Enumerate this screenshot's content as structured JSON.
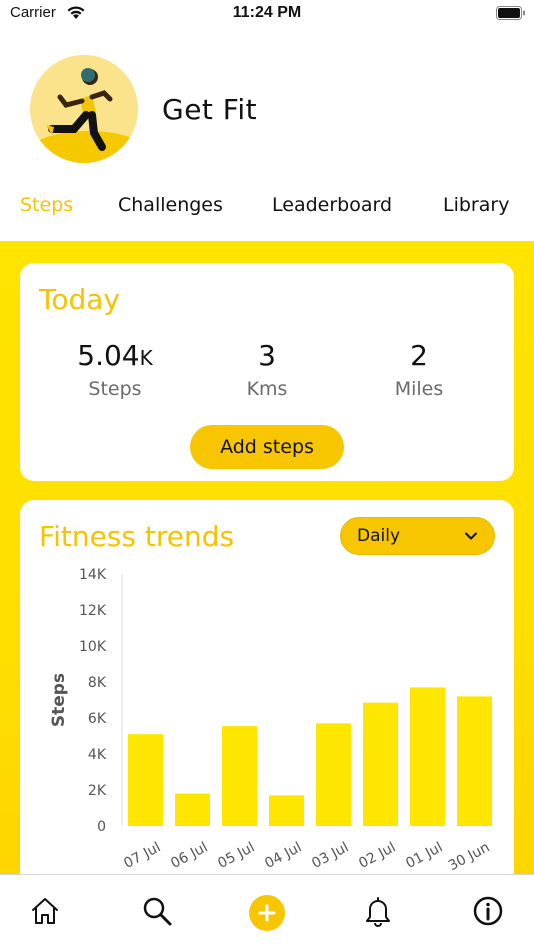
{
  "status_bar": {
    "carrier": "Carrier",
    "time": "11:24 PM"
  },
  "header": {
    "title": "Get Fit"
  },
  "tabs": [
    {
      "label": "Steps",
      "active": true
    },
    {
      "label": "Challenges",
      "active": false
    },
    {
      "label": "Leaderboard",
      "active": false
    },
    {
      "label": "Library",
      "active": false
    }
  ],
  "today": {
    "title": "Today",
    "stats": [
      {
        "value": "5.04",
        "unit": "K",
        "label": "Steps"
      },
      {
        "value": "3",
        "unit": "",
        "label": "Kms"
      },
      {
        "value": "2",
        "unit": "",
        "label": "Miles"
      }
    ],
    "add_button": "Add steps"
  },
  "trends": {
    "title": "Fitness trends",
    "period": "Daily"
  },
  "chart_data": {
    "type": "bar",
    "categories": [
      "07 Jul",
      "06 Jul",
      "05 Jul",
      "04 Jul",
      "03 Jul",
      "02 Jul",
      "01 Jul",
      "30 Jun"
    ],
    "values": [
      5100,
      1800,
      5550,
      1700,
      5700,
      6850,
      7700,
      7200
    ],
    "ylabel": "Steps",
    "ylim": [
      0,
      14000
    ],
    "yticks": [
      0,
      2000,
      4000,
      6000,
      8000,
      10000,
      12000,
      14000
    ],
    "ytick_labels": [
      "0",
      "2K",
      "4K",
      "6K",
      "8K",
      "10K",
      "12K",
      "14K"
    ],
    "bar_color": "#ffe600",
    "grid": false
  },
  "bottom_nav": [
    "home",
    "search",
    "add",
    "notifications",
    "info"
  ],
  "colors": {
    "accent": "#f5c400",
    "bar": "#ffe600",
    "background_yellow": "#ffdf00"
  }
}
